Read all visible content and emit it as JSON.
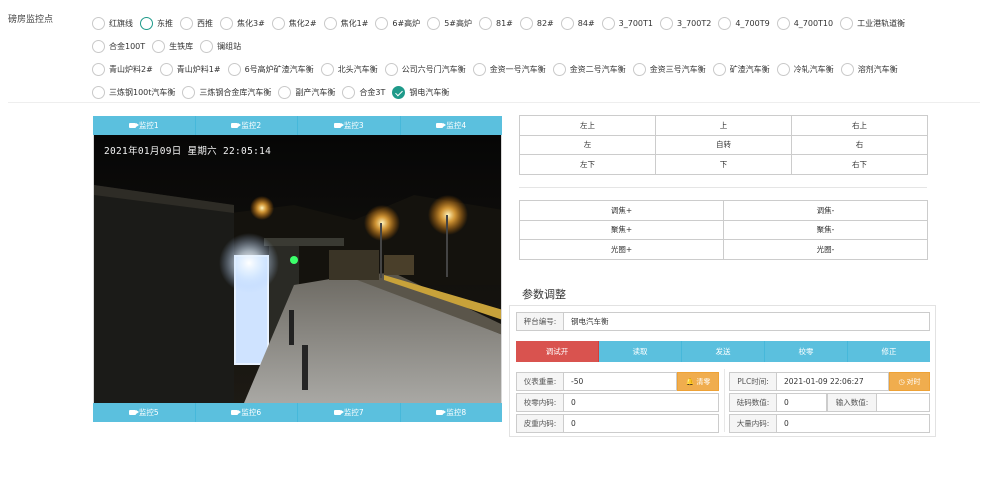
{
  "section_label": "磅房监控点",
  "radio_rows": [
    [
      {
        "label": "红旗线",
        "state": "none"
      },
      {
        "label": "东推",
        "state": "selected"
      },
      {
        "label": "西推",
        "state": "none"
      },
      {
        "label": "焦化3#",
        "state": "none"
      },
      {
        "label": "焦化2#",
        "state": "none"
      },
      {
        "label": "焦化1#",
        "state": "none"
      },
      {
        "label": "6#高炉",
        "state": "none"
      },
      {
        "label": "5#高炉",
        "state": "none"
      },
      {
        "label": "81#",
        "state": "none"
      },
      {
        "label": "82#",
        "state": "none"
      },
      {
        "label": "84#",
        "state": "none"
      },
      {
        "label": "3_700T1",
        "state": "none"
      },
      {
        "label": "3_700T2",
        "state": "none"
      },
      {
        "label": "4_700T9",
        "state": "none"
      },
      {
        "label": "4_700T10",
        "state": "none"
      },
      {
        "label": "工业港轨道衡",
        "state": "none"
      }
    ],
    [
      {
        "label": "合金100T",
        "state": "none"
      },
      {
        "label": "生铁库",
        "state": "none"
      },
      {
        "label": "镧组站",
        "state": "none"
      }
    ],
    [
      {
        "label": "青山炉料2#",
        "state": "none"
      },
      {
        "label": "青山炉料1#",
        "state": "none"
      },
      {
        "label": "6号高炉矿渣汽车衡",
        "state": "none"
      },
      {
        "label": "北头汽车衡",
        "state": "none"
      },
      {
        "label": "公司六号门汽车衡",
        "state": "none"
      },
      {
        "label": "金资一号汽车衡",
        "state": "none"
      },
      {
        "label": "金资二号汽车衡",
        "state": "none"
      },
      {
        "label": "金资三号汽车衡",
        "state": "none"
      },
      {
        "label": "矿渣汽车衡",
        "state": "none"
      },
      {
        "label": "冷轧汽车衡",
        "state": "none"
      },
      {
        "label": "溶剂汽车衡",
        "state": "none"
      }
    ],
    [
      {
        "label": "三炼钢100t汽车衡",
        "state": "none"
      },
      {
        "label": "三炼钢合金库汽车衡",
        "state": "none"
      },
      {
        "label": "副产汽车衡",
        "state": "none"
      },
      {
        "label": "合金3T",
        "state": "none"
      },
      {
        "label": "钢电汽车衡",
        "state": "checked"
      }
    ]
  ],
  "cameras_top": [
    "监控1",
    "监控2",
    "监控3",
    "监控4"
  ],
  "cameras_bottom": [
    "监控5",
    "监控6",
    "监控7",
    "监控8"
  ],
  "video": {
    "osd_timestamp": "2021年01月09日  星期六  22:05:14"
  },
  "ptz_buttons": [
    "左上",
    "上",
    "右上",
    "左",
    "自转",
    "右",
    "左下",
    "下",
    "右下"
  ],
  "lens_buttons": [
    "调焦+",
    "调焦-",
    "聚焦+",
    "聚焦-",
    "光圈+",
    "光圈-"
  ],
  "params": {
    "title": "参数调整",
    "scale_no_label": "秤台编号:",
    "scale_no_value": "钢电汽车衡",
    "actions": [
      "调试开",
      "读取",
      "发送",
      "校零",
      "修正"
    ],
    "meter_weight_label": "仪表重量:",
    "meter_weight_value": "-50",
    "clear_label": "清零",
    "plc_time_label": "PLC时间:",
    "plc_time_value": "2021-01-09 22:06:27",
    "sync_label": "对时",
    "zero_code_label": "校零内码:",
    "zero_code_value": "0",
    "weight_value_label": "砝码数值:",
    "weight_value_value": "0",
    "input_value_label": "输入数值:",
    "input_value_value": "",
    "tare_code_label": "皮重内码:",
    "tare_code_value": "0",
    "bulk_code_label": "大量内码:",
    "bulk_code_value": "0"
  },
  "colors": {
    "accent": "#5bc0de",
    "danger": "#d9534f",
    "warning": "#f0ad4e",
    "radio_checked": "#1f9a8a"
  }
}
